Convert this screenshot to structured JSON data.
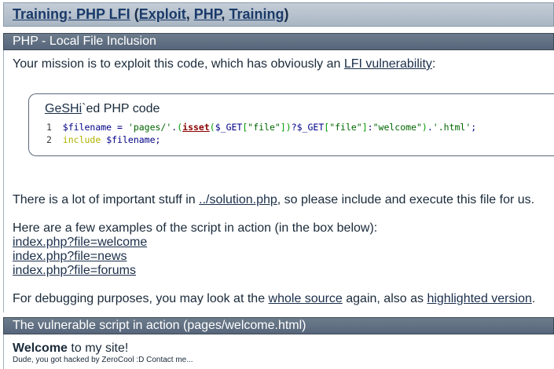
{
  "header": {
    "title_link": "Training: PHP LFI",
    "open_paren": " (",
    "tags": [
      "Exploit",
      "PHP",
      "Training"
    ],
    "close_paren": ")"
  },
  "section1": {
    "title": "PHP - Local File Inclusion",
    "mission_prefix": "Your mission is to exploit this code, which has obviously an ",
    "mission_link": "LFI vulnerability",
    "mission_suffix": ":",
    "code_caption_link": "GeSHi",
    "code_caption_rest": "`ed PHP code",
    "code_lines": [
      {
        "num": "1",
        "text": "$filename = 'pages/'.(isset($_GET[\"file\"])?$_GET[\"file\"]:\"welcome\").'.html';"
      },
      {
        "num": "2",
        "text": "include $filename;"
      }
    ],
    "stuff_prefix": "There is a lot of important stuff in ",
    "stuff_link": "../solution.php",
    "stuff_suffix": ", so please include and execute this file for us.",
    "examples_intro": "Here are a few examples of the script in action (in the box below):",
    "example_links": [
      "index.php?file=welcome",
      "index.php?file=news",
      "index.php?file=forums"
    ],
    "debug_prefix": "For debugging purposes, you may look at the ",
    "debug_link1": "whole source",
    "debug_mid": " again, also as ",
    "debug_link2": "highlighted version",
    "debug_suffix": "."
  },
  "section2": {
    "title": "The vulnerable script in action (pages/welcome.html)",
    "welcome_bold": "Welcome",
    "welcome_rest": " to my site!",
    "footer_note": "Dude, you got hacked by ZeroCool :D Contact me..."
  }
}
